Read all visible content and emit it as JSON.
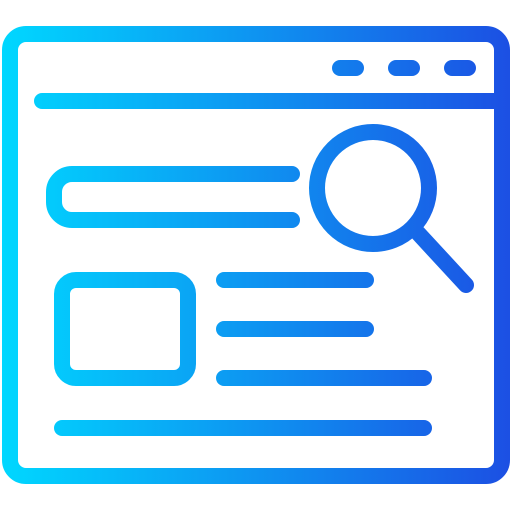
{
  "icon": {
    "name": "web-search-icon",
    "colors": {
      "gradient_start": "#00d8ff",
      "gradient_end": "#1c4fe3",
      "background": "#ffffff"
    }
  }
}
